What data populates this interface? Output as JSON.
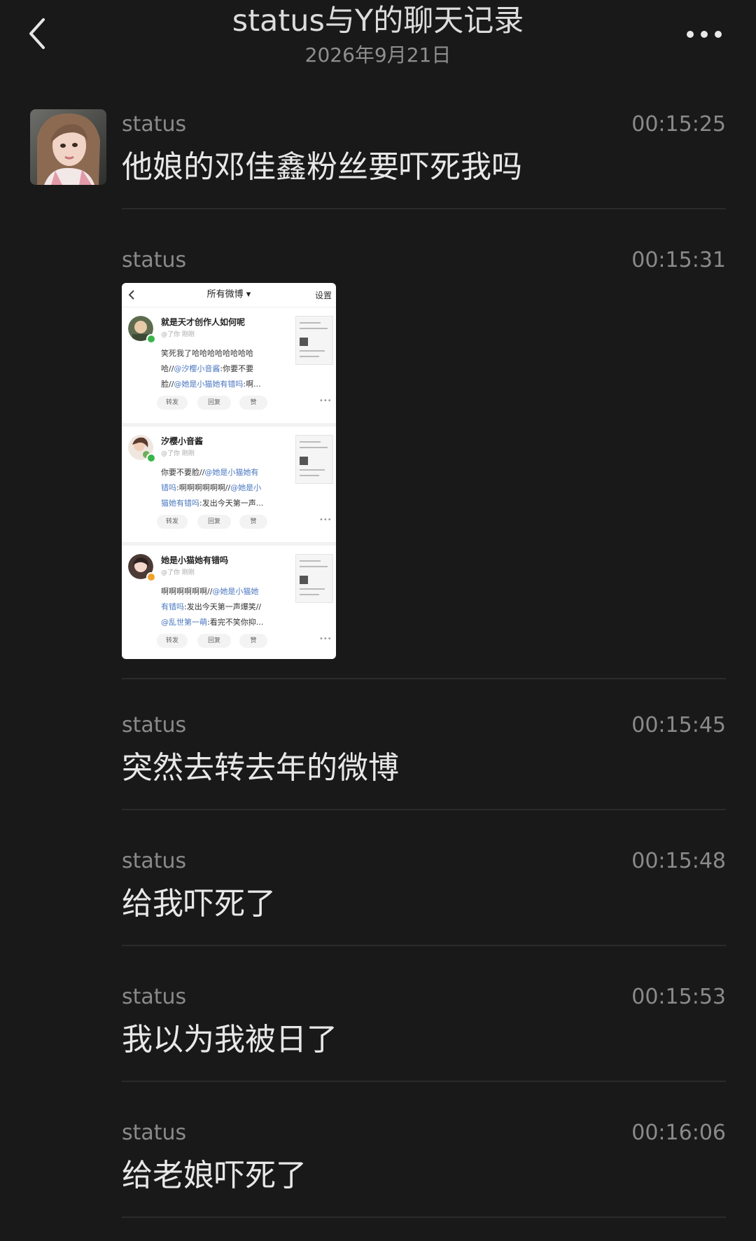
{
  "header": {
    "title": "status与Y的聊天记录",
    "date": "2026年9月21日"
  },
  "messages": [
    {
      "sender": "status",
      "time": "00:15:25",
      "text": "他娘的邓佳鑫粉丝要吓死我吗"
    },
    {
      "sender": "status",
      "time": "00:15:31",
      "type": "image"
    },
    {
      "sender": "status",
      "time": "00:15:45",
      "text": "突然去转去年的微博"
    },
    {
      "sender": "status",
      "time": "00:15:48",
      "text": "给我吓死了"
    },
    {
      "sender": "status",
      "time": "00:15:53",
      "text": "我以为我被日了"
    },
    {
      "sender": "status",
      "time": "00:16:06",
      "text": "给老娘吓死了"
    }
  ],
  "screenshot": {
    "title": "所有微博 ▾",
    "settings": "设置",
    "actions": [
      "转发",
      "回复",
      "赞"
    ],
    "posts": [
      {
        "name": "就是天才创作人如何呢",
        "meta": "@了你  刚刚",
        "lines": [
          {
            "t": "笑死我了哈哈哈哈哈哈哈哈"
          },
          {
            "t": "哈//",
            "at": "@汐樱小音酱",
            "t2": ":你要不要"
          },
          {
            "t": "脸//",
            "at": "@她是小猫她有错吗",
            "t2": ":啊..."
          }
        ]
      },
      {
        "name": "汐樱小音酱",
        "meta": "@了你  刚刚",
        "lines": [
          {
            "t": "你要不要脸//",
            "at": "@她是小猫她有"
          },
          {
            "at": "错吗",
            "t2": ":啊啊啊啊啊啊//",
            "at2": "@她是小"
          },
          {
            "at": "猫她有错吗",
            "t2": ":发出今天第一声..."
          }
        ]
      },
      {
        "name": "她是小猫她有错吗",
        "meta": "@了你  刚刚",
        "lines": [
          {
            "t": "啊啊啊啊啊啊//",
            "at": "@她是小猫她"
          },
          {
            "at": "有错吗",
            "t2": ":发出今天第一声爆笑//"
          },
          {
            "at": "@乱世第一萌",
            "t2": ":看完不笑你抑..."
          }
        ]
      }
    ]
  },
  "colors": {
    "background": "#191919",
    "text_primary": "#e8e8e8",
    "text_secondary": "#8a8a8a",
    "link": "#4a78c0"
  },
  "icons": {
    "back": "chevron-left-icon",
    "more": "more-horizontal-icon"
  }
}
